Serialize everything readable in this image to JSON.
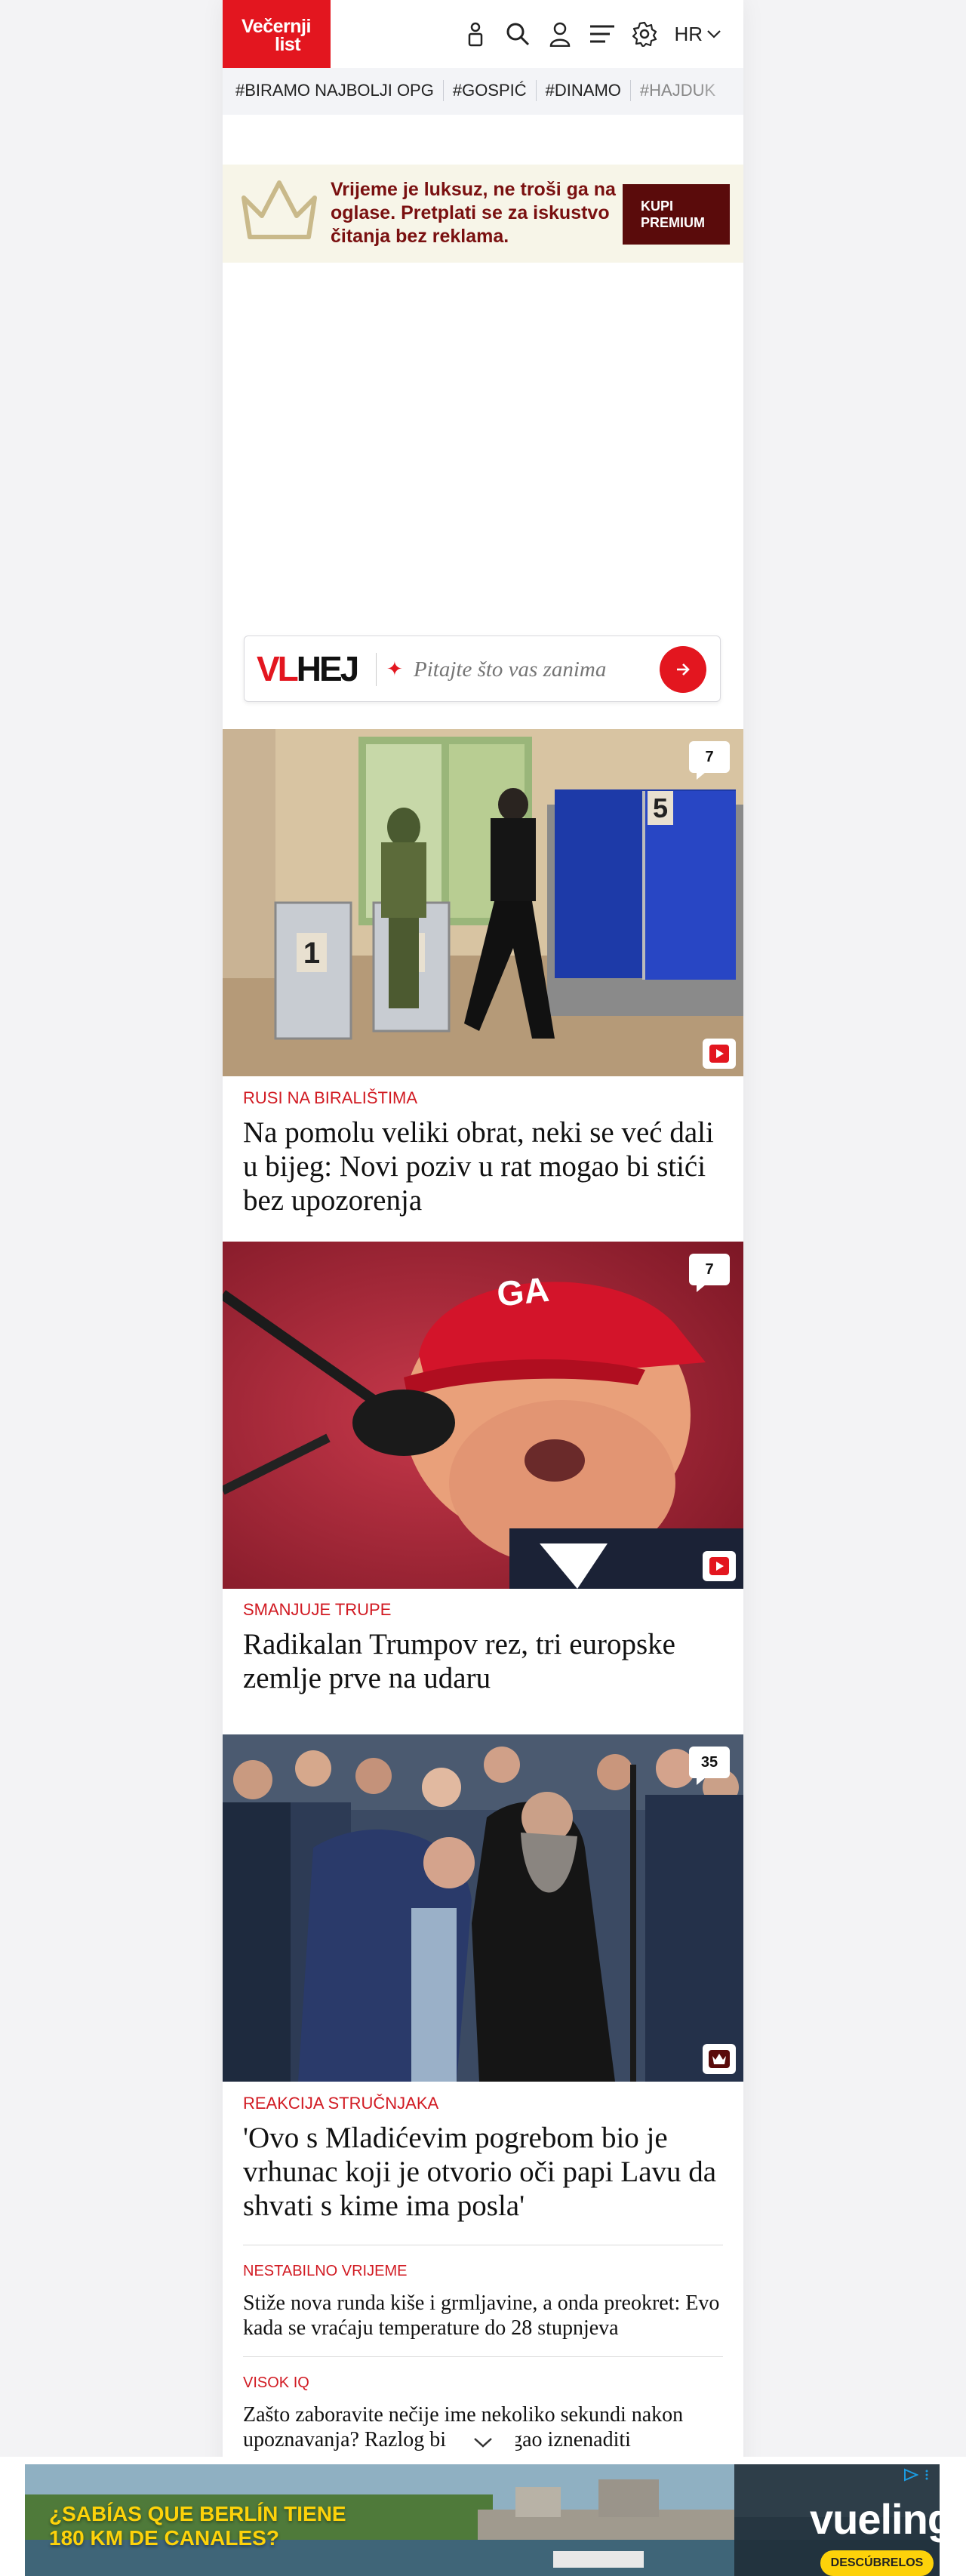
{
  "header": {
    "logo_line1": "Večernji",
    "logo_line2": "list",
    "language": "HR"
  },
  "tags": [
    "#BIRAMO NAJBOLJI OPG",
    "#GOSPIĆ",
    "#DINAMO",
    "#HAJDUK"
  ],
  "premium": {
    "text": "Vrijeme je luksuz, ne troši ga na oglase. Pretplati se za iskustvo čitanja bez reklama.",
    "button_line1": "KUPI",
    "button_line2": "PREMIUM"
  },
  "ask": {
    "brand_red": "VL",
    "brand_black": "HEJ",
    "placeholder": "Pitajte što vas zanima"
  },
  "articles": [
    {
      "comments": "7",
      "kicker": "RUSI NA BIRALIŠTIMA",
      "title": "Na pomolu veliki obrat, neki se već dali u bijeg: Novi poziv u rat mogao bi stići bez upozorenja",
      "media": "video",
      "booth_labels": [
        "1",
        "2",
        "5"
      ]
    },
    {
      "comments": "7",
      "kicker": "SMANJUJE TRUPE",
      "title": "Radikalan Trumpov rez, tri europske zemlje prve na udaru",
      "media": "video",
      "cap_text": "GA"
    },
    {
      "comments": "35",
      "kicker": "REAKCIJA STRUČNJAKA",
      "title": "'Ovo s Mladićevim pogrebom bio je vrhunac koji je otvorio oči papi Lavu da shvati s kime ima posla'",
      "media": "premium"
    }
  ],
  "small_articles": [
    {
      "kicker": "NESTABILNO VRIJEME",
      "title": "Stiže nova runda kiše i grmljavine, a onda preokret: Evo kada se vraćaju temperature do 28 stupnjeva"
    },
    {
      "kicker": "VISOK IQ",
      "title": "Zašto zaboravite nečije ime nekoliko sekundi nakon upoznavanja? Razlog bi vas mogao iznenaditi"
    }
  ],
  "ad": {
    "line1": "¿SABÍAS QUE BERLÍN TIENE",
    "line2": "180 KM DE CANALES?",
    "brand": "vueling",
    "button": "DESCÚBRELOS"
  },
  "colors": {
    "brand_red": "#e3161f",
    "premium_bg": "#f7f5e8",
    "premium_text": "#7a1010",
    "premium_button": "#5a0b0b",
    "kicker_red": "#d11a22",
    "ad_yellow": "#fdd20a"
  },
  "icons": [
    "user-pin-icon",
    "search-icon",
    "person-icon",
    "menu-icon",
    "gear-icon",
    "chevron-down-icon",
    "crown-icon",
    "sparkle-icon",
    "arrow-right-icon",
    "comment-icon",
    "play-icon",
    "premium-crown-icon",
    "adchoices-icon",
    "close-icon"
  ]
}
